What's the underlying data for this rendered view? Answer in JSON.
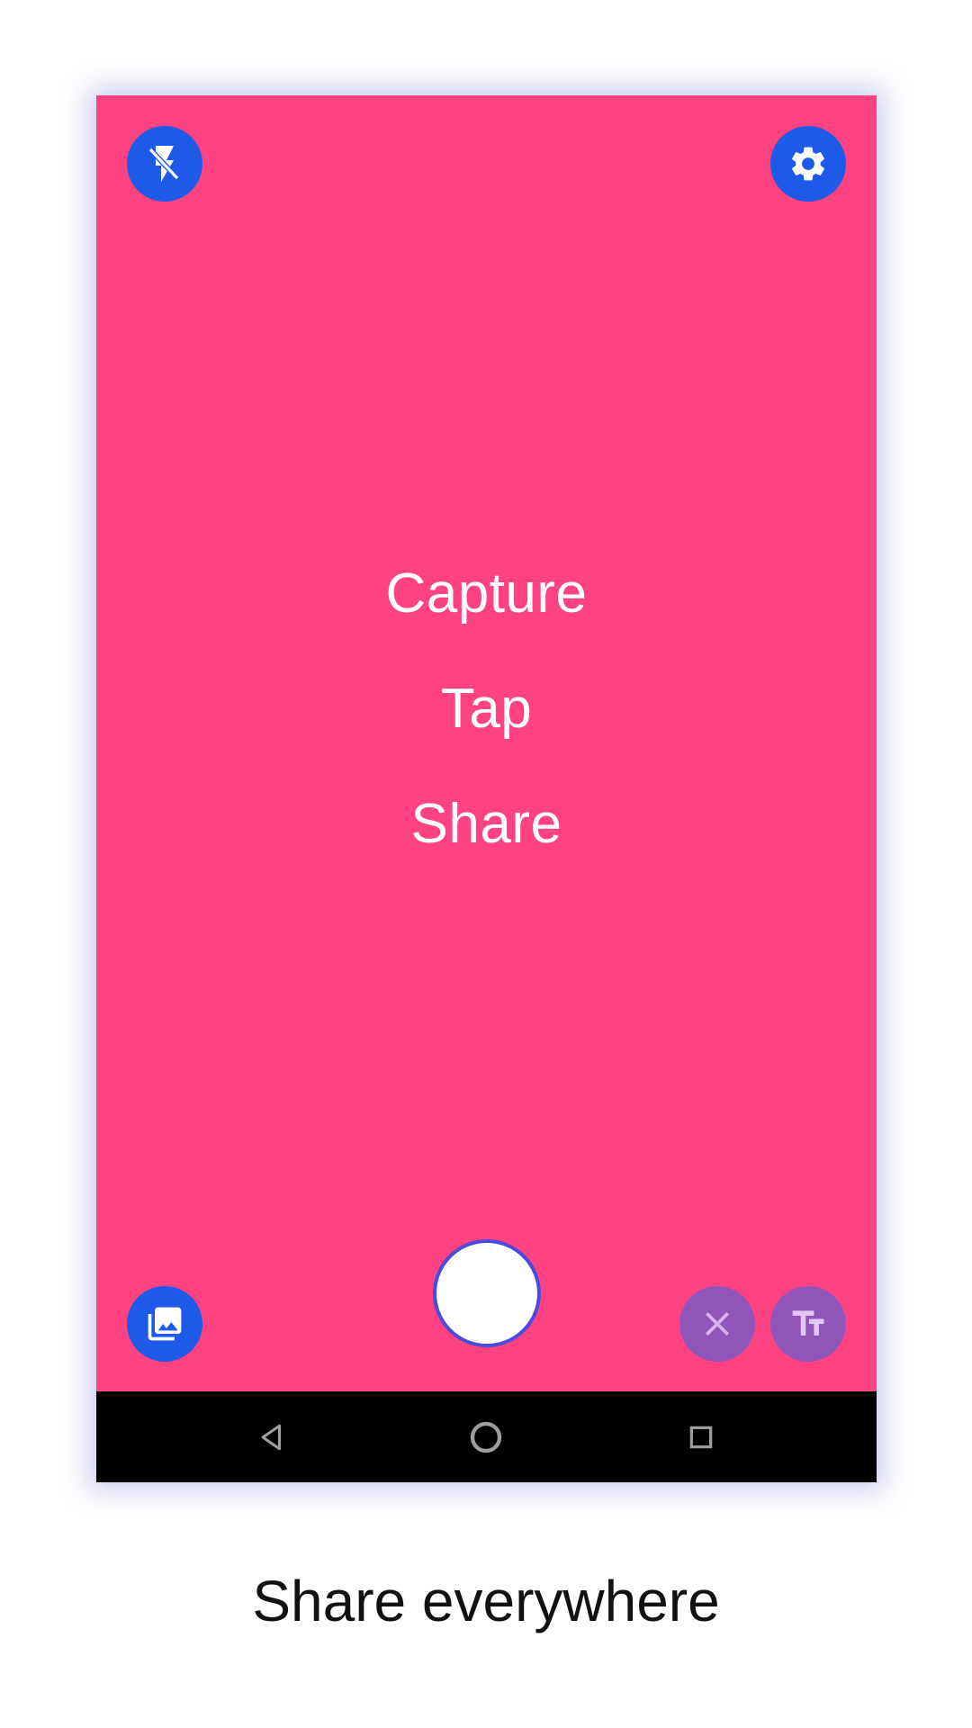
{
  "viewfinder": {
    "background_color": "#ff4281",
    "words": [
      "Capture",
      "Tap",
      "Share"
    ]
  },
  "controls": {
    "top_left": {
      "icon": "flash-off-icon"
    },
    "top_right": {
      "icon": "gear-icon"
    },
    "bottom_left": {
      "icon": "gallery-icon"
    },
    "bottom_right": [
      {
        "icon": "close-icon"
      },
      {
        "icon": "text-size-icon"
      }
    ],
    "shutter": {
      "icon": "shutter-button"
    }
  },
  "colors": {
    "fab_blue": "#1e5ae8",
    "fab_purple": "#9155ba",
    "nav_bar": "#000000"
  },
  "navbar": {
    "items": [
      {
        "icon": "back-triangle-icon"
      },
      {
        "icon": "home-circle-icon"
      },
      {
        "icon": "recents-square-icon"
      }
    ]
  },
  "caption": {
    "text": "Share everywhere"
  }
}
